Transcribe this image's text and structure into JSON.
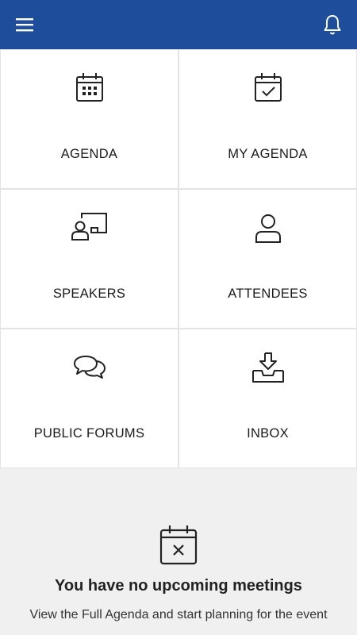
{
  "header": {
    "menu_icon": "hamburger-menu-icon",
    "notifications_icon": "bell-icon",
    "background_color": "#1d4d9b"
  },
  "tiles": [
    {
      "label": "AGENDA",
      "icon": "calendar-grid-icon"
    },
    {
      "label": "MY AGENDA",
      "icon": "calendar-check-icon"
    },
    {
      "label": "SPEAKERS",
      "icon": "presenter-board-icon"
    },
    {
      "label": "ATTENDEES",
      "icon": "person-icon"
    },
    {
      "label": "PUBLIC FORUMS",
      "icon": "chat-bubbles-icon"
    },
    {
      "label": "INBOX",
      "icon": "inbox-download-icon"
    }
  ],
  "meetings": {
    "icon": "calendar-x-icon",
    "title": "You have no upcoming meetings",
    "text": "View the Full Agenda and start planning for the event"
  }
}
